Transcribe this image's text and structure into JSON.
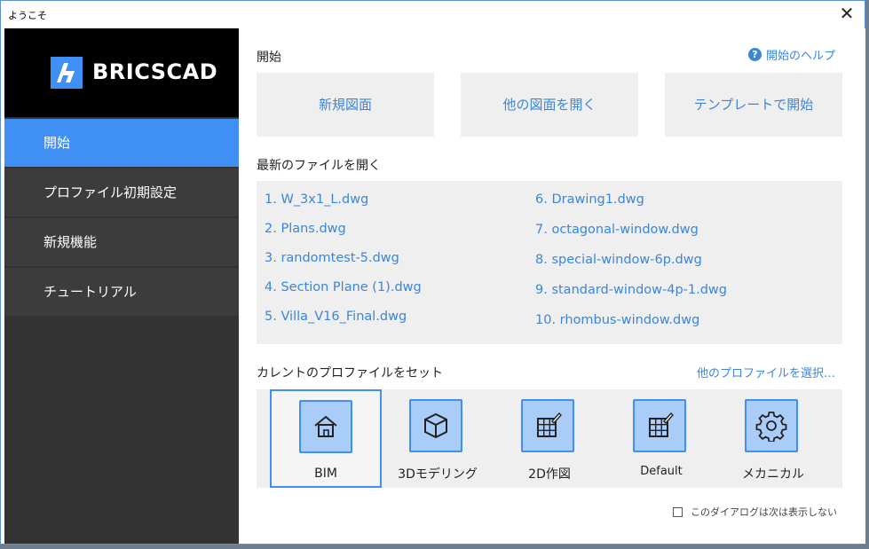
{
  "window": {
    "title": "ようこそ",
    "close": "✕"
  },
  "logo": {
    "text": "BRICSCAD"
  },
  "sidebar": {
    "items": [
      {
        "label": "開始",
        "active": true
      },
      {
        "label": "プロファイル初期設定",
        "active": false
      },
      {
        "label": "新規機能",
        "active": false
      },
      {
        "label": "チュートリアル",
        "active": false
      }
    ]
  },
  "start": {
    "title": "開始",
    "help": "開始のヘルプ",
    "buttons": {
      "new": "新規図面",
      "open": "他の図面を開く",
      "template": "テンプレートで開始"
    }
  },
  "recent": {
    "title": "最新のファイルを開く",
    "left": [
      "1. W_3x1_L.dwg",
      "2. Plans.dwg",
      "3. randomtest-5.dwg",
      "4. Section Plane (1).dwg",
      "5. Villa_V16_Final.dwg"
    ],
    "right": [
      "6. Drawing1.dwg",
      "7. octagonal-window.dwg",
      "8. special-window-6p.dwg",
      "9. standard-window-4p-1.dwg",
      "10. rhombus-window.dwg"
    ]
  },
  "profile": {
    "title": "カレントのプロファイルをセット",
    "select_other": "他のプロファイルを選択…",
    "items": [
      {
        "label": "BIM",
        "icon": "house-icon"
      },
      {
        "label": "3Dモデリング",
        "icon": "cube-icon"
      },
      {
        "label": "2D作図",
        "icon": "grid-pencil-icon"
      },
      {
        "label": "Default",
        "icon": "grid-pencil-icon"
      },
      {
        "label": "メカニカル",
        "icon": "gear-icon"
      }
    ]
  },
  "footer": {
    "dont_show": "このダイアログは次は表示しない"
  },
  "colors": {
    "accent": "#3f8ff5",
    "link": "#3c86d9",
    "sidebar": "#333333",
    "icon_fill": "#a9cdf8"
  }
}
